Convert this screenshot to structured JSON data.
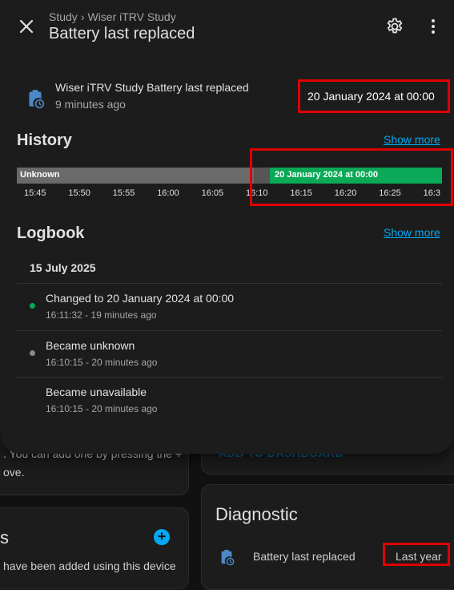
{
  "background": {
    "left_text_line1": ". You can add one by pressing the +",
    "left_text_line2": "ove.",
    "right_link": "ADD TO DASHBOARD",
    "left_heading": "s",
    "left_bottom_text": "have been added using this device",
    "diagnostic_heading": "Diagnostic",
    "diag_row_label": "Battery last replaced",
    "diag_row_value": "Last year"
  },
  "header": {
    "breadcrumb": [
      "Study",
      "Wiser iTRV Study"
    ],
    "breadcrumb_sep": "›",
    "title": "Battery last replaced"
  },
  "entity": {
    "name": "Wiser iTRV Study Battery last replaced",
    "last_changed": "9 minutes ago",
    "state": "20 January 2024 at 00:00"
  },
  "history": {
    "heading": "History",
    "show_more": "Show more",
    "segments": [
      {
        "label": "Unknown",
        "fraction": 0.595,
        "color": "#6a6a6a"
      },
      {
        "label": "20 January 2024 at 00:00",
        "fraction": 0.405,
        "color": "#0aa857"
      }
    ],
    "ticks": [
      "15:45",
      "15:50",
      "15:55",
      "16:00",
      "16:05",
      "16:10",
      "16:15",
      "16:20",
      "16:25",
      "16:3"
    ]
  },
  "logbook": {
    "heading": "Logbook",
    "show_more": "Show more",
    "date": "15 July 2025",
    "entries": [
      {
        "title": "Changed to 20 January 2024 at 00:00",
        "time": "16:11:32 - 19 minutes ago",
        "dot_color": "#0aa857"
      },
      {
        "title": "Became unknown",
        "time": "16:10:15 - 20 minutes ago",
        "dot_color": "#8a8a8a"
      },
      {
        "title": "Became unavailable",
        "time": "16:10:15 - 20 minutes ago",
        "dot_color": ""
      }
    ]
  },
  "colors": {
    "accent": "#03a9f4",
    "highlight": "#e00000",
    "state_green": "#0aa857"
  }
}
